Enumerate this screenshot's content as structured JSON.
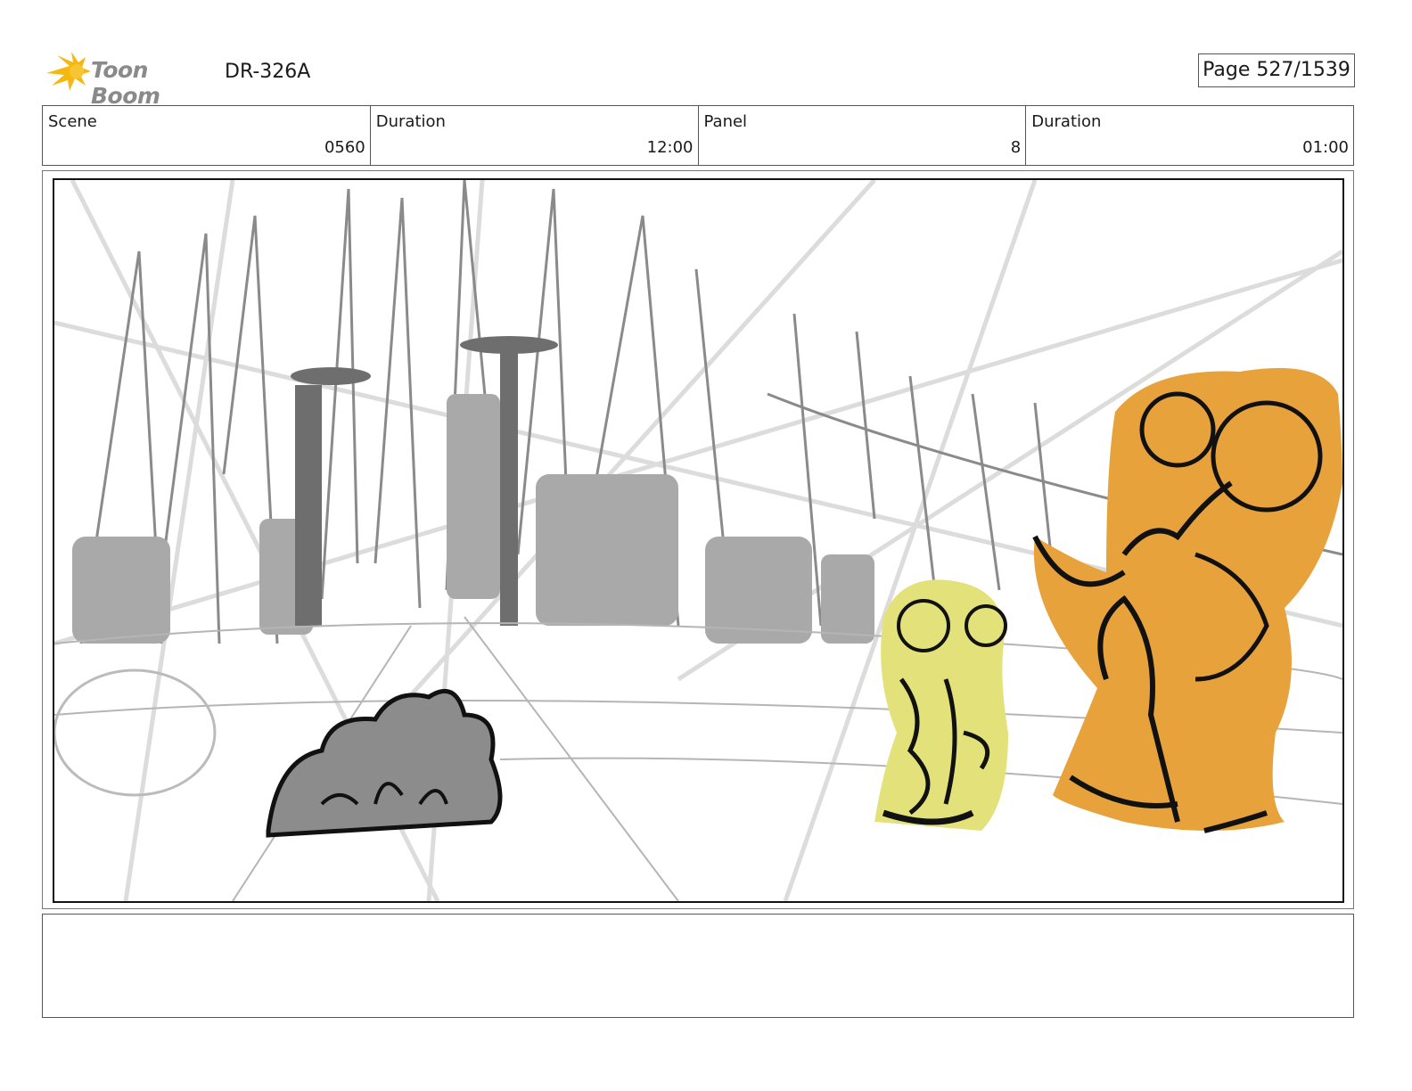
{
  "header": {
    "logo_text": "Toon Boom",
    "doc_code": "DR-326A",
    "page_label": "Page",
    "page_value": "527/1539"
  },
  "info": {
    "scene_label": "Scene",
    "scene_value": "0560",
    "scene_duration_label": "Duration",
    "scene_duration_value": "12:00",
    "panel_label": "Panel",
    "panel_value": "8",
    "panel_duration_label": "Duration",
    "panel_duration_value": "01:00"
  },
  "notes": {
    "text": ""
  },
  "colors": {
    "logo_accent": "#f5b80f",
    "character_yellow": "#e3e27a",
    "character_orange": "#e8a23c",
    "bush_gray": "#8c8c8c"
  },
  "icons": [
    "toon-boom-logo-icon"
  ]
}
